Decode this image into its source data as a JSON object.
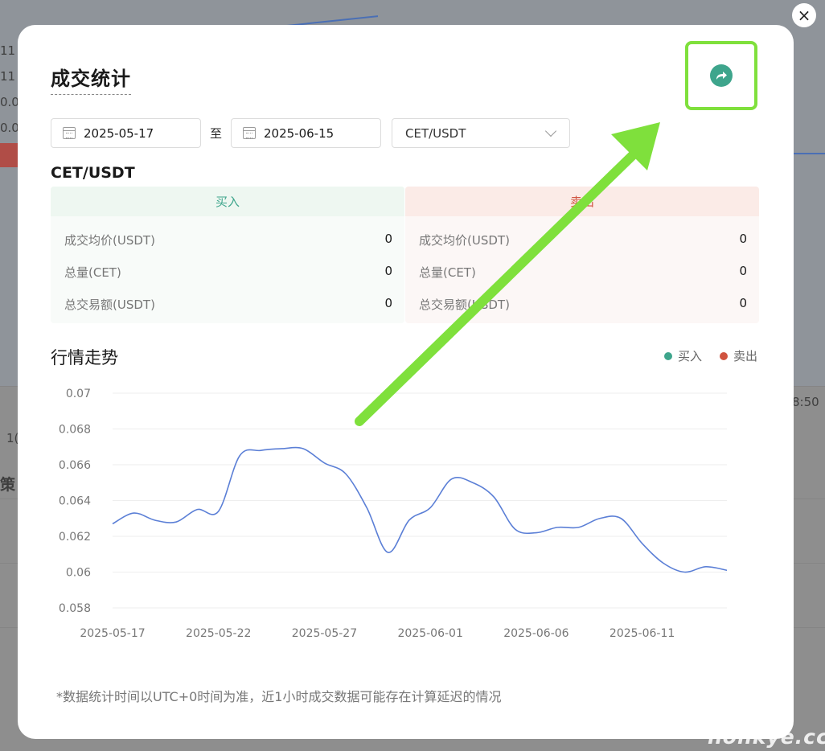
{
  "background": {
    "texts": [
      "11",
      "11",
      "0.0",
      "0.0",
      "8:50",
      "1(",
      "策"
    ]
  },
  "close_icon": "×",
  "modal": {
    "title": "成交统计",
    "share_icon": "share-arrow-icon",
    "start_date": "2025-05-17",
    "date_separator": "至",
    "end_date": "2025-06-15",
    "pair_selected": "CET/USDT",
    "pair_title": "CET/USDT",
    "buy": {
      "label": "买入",
      "rows": [
        {
          "key": "成交均价(USDT)",
          "value": "0"
        },
        {
          "key": "总量(CET)",
          "value": "0"
        },
        {
          "key": "总交易额(USDT)",
          "value": "0"
        }
      ]
    },
    "sell": {
      "label": "卖出",
      "rows": [
        {
          "key": "成交均价(USDT)",
          "value": "0"
        },
        {
          "key": "总量(CET)",
          "value": "0"
        },
        {
          "key": "总交易额(USDT)",
          "value": "0"
        }
      ]
    },
    "trend_title": "行情走势",
    "legend_buy": "买入",
    "legend_sell": "卖出",
    "footnote": "*数据统计时间以UTC+0时间为准，近1小时成交数据可能存在计算延迟的情况"
  },
  "colors": {
    "buy": "#3ea58c",
    "sell": "#d0533f",
    "line": "#5b7fd6",
    "highlight": "#7fe03c"
  },
  "chart_data": {
    "type": "line",
    "title": "行情走势",
    "xlabel": "",
    "ylabel": "",
    "ylim": [
      0.058,
      0.07
    ],
    "y_ticks": [
      0.07,
      0.068,
      0.066,
      0.064,
      0.062,
      0.06,
      0.058
    ],
    "y_tick_labels": [
      "0.07",
      "0.068",
      "0.066",
      "0.064",
      "0.062",
      "0.06",
      "0.058"
    ],
    "x_tick_labels": [
      "2025-05-17",
      "2025-05-22",
      "2025-05-27",
      "2025-06-01",
      "2025-06-06",
      "2025-06-11"
    ],
    "x_tick_index": [
      0,
      5,
      10,
      15,
      20,
      25
    ],
    "x": [
      "2025-05-17",
      "2025-05-18",
      "2025-05-19",
      "2025-05-20",
      "2025-05-21",
      "2025-05-22",
      "2025-05-23",
      "2025-05-24",
      "2025-05-25",
      "2025-05-26",
      "2025-05-27",
      "2025-05-28",
      "2025-05-29",
      "2025-05-30",
      "2025-05-31",
      "2025-06-01",
      "2025-06-02",
      "2025-06-03",
      "2025-06-04",
      "2025-06-05",
      "2025-06-06",
      "2025-06-07",
      "2025-06-08",
      "2025-06-09",
      "2025-06-10",
      "2025-06-11",
      "2025-06-12",
      "2025-06-13",
      "2025-06-14"
    ],
    "series": [
      {
        "name": "",
        "values": [
          0.0627,
          0.0633,
          0.0629,
          0.0628,
          0.0635,
          0.0634,
          0.0665,
          0.0668,
          0.0669,
          0.0669,
          0.0661,
          0.0655,
          0.0636,
          0.0611,
          0.0629,
          0.0636,
          0.0652,
          0.065,
          0.0642,
          0.0624,
          0.0622,
          0.0625,
          0.0625,
          0.063,
          0.063,
          0.0616,
          0.0605,
          0.06,
          0.0603,
          0.0601
        ]
      }
    ],
    "legend": [
      "买入",
      "卖出"
    ],
    "legend_position": "top-right",
    "grid": true
  },
  "watermark": "nonkye.cc"
}
